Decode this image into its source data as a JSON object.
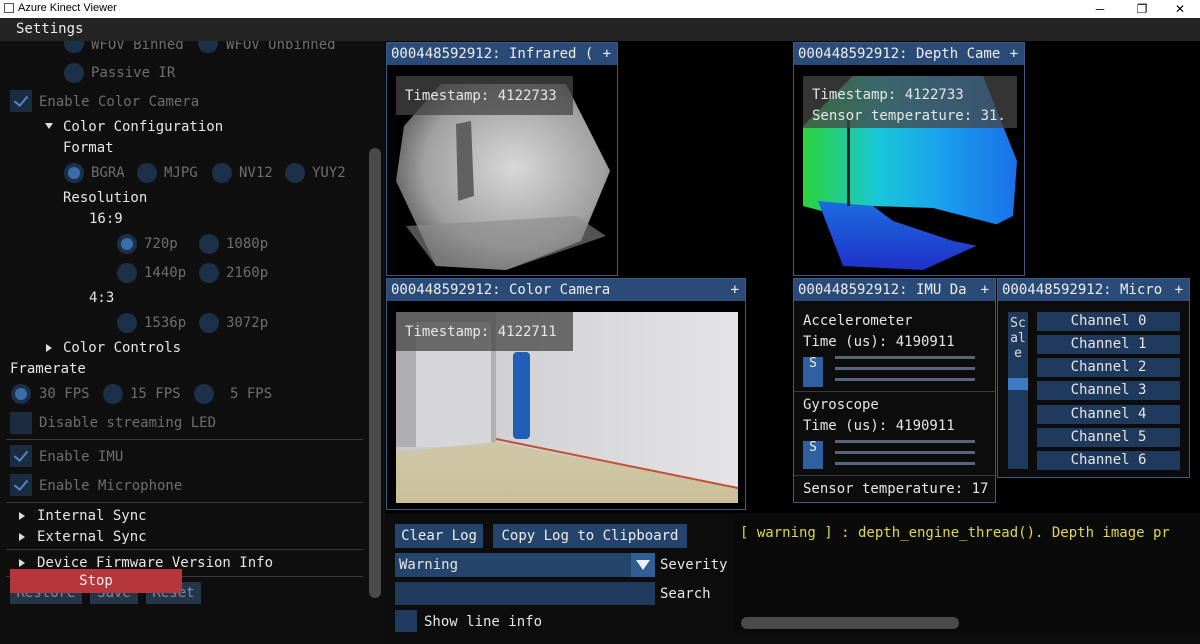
{
  "window": {
    "title": "Azure Kinect Viewer",
    "minimize": "─",
    "maximize": "❐",
    "close": "✕"
  },
  "menu": {
    "settings": "Settings"
  },
  "settings": {
    "wfov_binned": "WFOV Binned",
    "wfov_unbinned": "WFOV Unbinned",
    "passive_ir": "Passive IR",
    "enable_color_camera": "Enable Color Camera",
    "color_configuration": "Color Configuration",
    "format_label": "Format",
    "formats": [
      "BGRA",
      "MJPG",
      "NV12",
      "YUY2"
    ],
    "resolution_label": "Resolution",
    "aspect_16_9": "16:9",
    "res_16_9": [
      "720p",
      "1080p",
      "1440p",
      "2160p"
    ],
    "aspect_4_3": "4:3",
    "res_4_3": [
      "1536p",
      "3072p"
    ],
    "color_controls": "Color Controls",
    "framerate_label": "Framerate",
    "framerates": [
      "30 FPS",
      "15 FPS",
      "5 FPS"
    ],
    "disable_led": "Disable streaming LED",
    "enable_imu": "Enable IMU",
    "enable_microphone": "Enable Microphone",
    "internal_sync": "Internal Sync",
    "external_sync": "External Sync",
    "firmware_info": "Device Firmware Version Info",
    "restore": "Restore",
    "save": "Save",
    "reset": "Reset",
    "stop": "Stop"
  },
  "infrared": {
    "title": "000448592912: Infrared (",
    "timestamp": "Timestamp: 4122733"
  },
  "depth": {
    "title": "000448592912: Depth Came",
    "timestamp": "Timestamp: 4122733",
    "temperature": "Sensor temperature: 31."
  },
  "color": {
    "title": "000448592912: Color Camera",
    "timestamp": "Timestamp: 4122711"
  },
  "imu": {
    "title": "000448592912: IMU Da",
    "accelerometer": "Accelerometer",
    "accel_time": "Time (us): 4190911",
    "gyroscope": "Gyroscope",
    "gyro_time": "Time (us): 4190911",
    "scale_short": "S",
    "temperature": "Sensor temperature: 17"
  },
  "micro": {
    "title": "000448592912: Micro",
    "scale": "Scale",
    "channels": [
      "Channel 0",
      "Channel 1",
      "Channel 2",
      "Channel 3",
      "Channel 4",
      "Channel 5",
      "Channel 6"
    ]
  },
  "log": {
    "clear": "Clear Log",
    "copy": "Copy Log to Clipboard",
    "message": "[ warning  ] : depth_engine_thread(). Depth image pr",
    "severity_value": "Warning",
    "severity_label": "Severity",
    "search_label": "Search",
    "search_value": "",
    "show_line_info": "Show line info"
  },
  "colors": {
    "accent": "#2a4b78",
    "stop": "#b5363b",
    "warning_text": "#e0d84a"
  }
}
